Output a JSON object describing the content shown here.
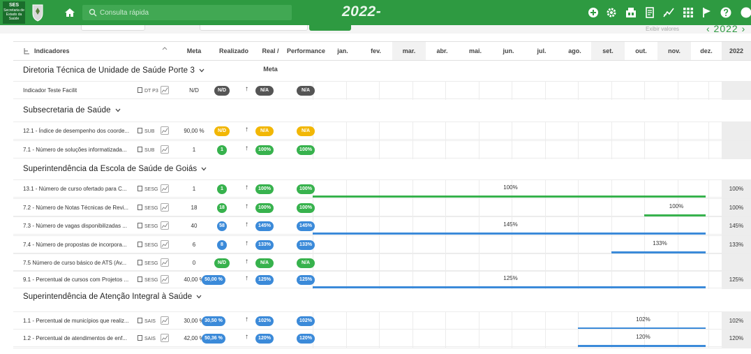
{
  "header": {
    "logo_title": "SES",
    "logo_subtitle": "Secretaria de Estado da Saúde",
    "search_placeholder": "Consulta rápida",
    "year": "2022-",
    "subbar_label": "Exibir valores",
    "year_nav": "‹ 2022 ›"
  },
  "colors": {
    "brand": "#2e9a41",
    "green": "#37b24d",
    "blue": "#3b8ad9",
    "yellow": "#f2b705",
    "dark": "#555555"
  },
  "table": {
    "columns": [
      "Indicadores",
      "Meta",
      "Realizado",
      "Real / Meta",
      "Performance",
      "jan.",
      "fev.",
      "mar.",
      "abr.",
      "mai.",
      "jun.",
      "jul.",
      "ago.",
      "set.",
      "out.",
      "nov.",
      "dez.",
      "2022"
    ]
  },
  "groups": [
    {
      "title": "Diretoria Técnica de Unidade de Saúde Porte 3",
      "rows": [
        {
          "name": "Indicador Teste Facilit",
          "unit": "DT P3",
          "meta": "N/D",
          "realizado": "N/D",
          "real_meta": "N/A",
          "performance": "N/A",
          "color": "dark",
          "year_value": "",
          "bar_label": ""
        }
      ]
    },
    {
      "title": "Subsecretaria de Saúde",
      "rows": [
        {
          "name": "12.1 - Índice de desempenho dos coorde...",
          "unit": "SUB",
          "meta": "90,00 %",
          "realizado": "N/D",
          "real_meta": "N/A",
          "performance": "N/A",
          "color": "yellow",
          "year_value": "",
          "bar_label": ""
        },
        {
          "name": "7.1 - Número de soluções informatizada...",
          "unit": "SUB",
          "meta": "1",
          "realizado": "1",
          "real_meta": "100%",
          "performance": "100%",
          "color": "green",
          "year_value": "",
          "bar_label": ""
        }
      ]
    },
    {
      "title": "Superintendência da Escola de Saúde de Goiás",
      "rows": [
        {
          "name": "13.1 - Número de curso ofertado para C...",
          "unit": "SESG",
          "meta": "1",
          "realizado": "1",
          "real_meta": "100%",
          "performance": "100%",
          "color": "green",
          "year_value": "100%",
          "bar_label": "100%"
        },
        {
          "name": "7.2 - Número de Notas Técnicas de Revi...",
          "unit": "SESG",
          "meta": "18",
          "realizado": "18",
          "real_meta": "100%",
          "performance": "100%",
          "color": "green",
          "year_value": "100%",
          "bar_label": "100%"
        },
        {
          "name": "7.3 - Número de vagas disponibilizadas ...",
          "unit": "SESG",
          "meta": "40",
          "realizado": "58",
          "real_meta": "145%",
          "performance": "145%",
          "color": "blue",
          "year_value": "145%",
          "bar_label": "145%"
        },
        {
          "name": "7.4 - Número de propostas de incorpora...",
          "unit": "SESG",
          "meta": "6",
          "realizado": "8",
          "real_meta": "133%",
          "performance": "133%",
          "color": "blue",
          "year_value": "133%",
          "bar_label": "133%"
        },
        {
          "name": "7.5 Número de curso básico de ATS (Av...",
          "unit": "SESG",
          "meta": "0",
          "realizado": "N/D",
          "real_meta": "N/A",
          "performance": "N/A",
          "color": "green",
          "year_value": "",
          "bar_label": ""
        },
        {
          "name": "9.1 - Percentual de cursos com Projetos ...",
          "unit": "SESG",
          "meta": "40,00 %",
          "realizado": "50,00 %",
          "real_meta": "125%",
          "performance": "125%",
          "color": "blue",
          "year_value": "125%",
          "bar_label": "125%"
        }
      ]
    },
    {
      "title": "Superintendência de Atenção Integral à Saúde",
      "rows": [
        {
          "name": "1.1 - Percentual de municípios que realiz...",
          "unit": "SAIS",
          "meta": "30,00 %",
          "realizado": "30,50 %",
          "real_meta": "102%",
          "performance": "102%",
          "color": "blue",
          "year_value": "102%",
          "bar_label": "102%"
        },
        {
          "name": "1.2 - Percentual de atendimentos de enf...",
          "unit": "SAIS",
          "meta": "42,00 %",
          "realizado": "50,36 %",
          "real_meta": "120%",
          "performance": "120%",
          "color": "blue",
          "year_value": "120%",
          "bar_label": "120%"
        }
      ]
    }
  ]
}
